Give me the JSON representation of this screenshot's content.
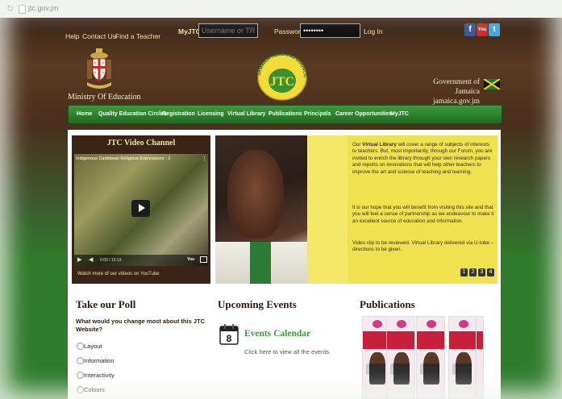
{
  "browser": {
    "url": "jtc.gov.jm"
  },
  "top_bar": {
    "links": [
      "Help",
      "Contact Us",
      "Find a Teacher"
    ],
    "myjtc_label": "MyJTC",
    "username_placeholder": "Username or TRN",
    "password_label": "Password",
    "password_value": "••••••••",
    "login_label": "Log In",
    "social": [
      {
        "name": "facebook-icon",
        "glyph": "f",
        "color": "#3b5998"
      },
      {
        "name": "youtube-icon",
        "glyph": "You",
        "color": "#c4302b"
      },
      {
        "name": "twitter-icon",
        "glyph": "t",
        "color": "#3fa9e0"
      }
    ]
  },
  "header": {
    "ministry": "Ministry Of Education",
    "jtc_logo_arc": "JAMAICA TEACHING COUNCIL",
    "jtc_logo_letters": "JTC",
    "government": "Government of Jamaica",
    "government_url": "jamaica.gov.jm"
  },
  "nav": {
    "items": [
      "Home",
      "Quality Education Circles",
      "Registration",
      "Licensing",
      "Virtual Library",
      "Publications",
      "Principals",
      "Career Opportunities",
      "MyJTC"
    ]
  },
  "video": {
    "title": "JTC Video Channel",
    "caption": "Indigenous Caribbean Religious Expressions - 2",
    "time": "0:00 / 13:13",
    "youtube_link": "Watch more of our videos on YouTube"
  },
  "feature": {
    "p1_prefix": "Our ",
    "p1_bold": "Virtual Library",
    "p1_rest": " will cover a range of subjects of interests to teachers. But, most importantly, through our Forum, you are invited to enrich the library through your own research papers and reports on innovations that will help other teachers to improve the art and science of teaching and learning.",
    "p2": "It is our hope that you will benefit from visiting this site and that you will feel a sense of partnership as we endeavour to make it an excellent source of education and information.",
    "p3": "Video clip to be reviewed. Virtual Library delivered via U-tube – directions to be given.",
    "pages": [
      "1",
      "2",
      "3",
      "4"
    ]
  },
  "poll": {
    "title": "Take our Poll",
    "question": "What would you change most about this JTC Website?",
    "options": [
      "Layout",
      "Information",
      "Interactivity",
      "Colours"
    ]
  },
  "events": {
    "title": "Upcoming Events",
    "calendar_day": "8",
    "link": "Events Calendar",
    "sub": "Click here to view all the events."
  },
  "publications": {
    "title": "Publications"
  }
}
